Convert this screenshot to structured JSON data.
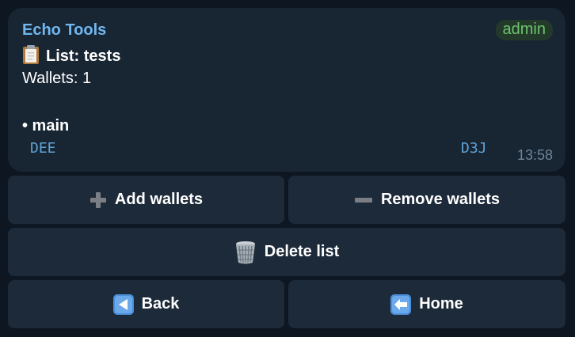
{
  "message": {
    "sender": "Echo Tools",
    "badge": "admin",
    "list_line": "List: tests",
    "wallets_line": "Wallets: 1",
    "item_line": "• main",
    "code_left": "DEE",
    "code_right": "D3J",
    "time": "13:58"
  },
  "keyboard": {
    "add_label": "Add wallets",
    "remove_label": "Remove wallets",
    "delete_label": "Delete list",
    "back_label": "Back",
    "home_label": "Home"
  },
  "icons": {
    "list": "clipboard-icon",
    "add": "plus-icon",
    "remove": "minus-icon",
    "delete": "wastebasket-icon",
    "back": "back-arrow-icon",
    "home": "left-arrow-icon"
  },
  "colors": {
    "background": "#0e1621",
    "bubble": "#182533",
    "sender": "#70b7f0",
    "badge_text": "#6dc46e",
    "code": "#5ea3d6",
    "button": "#1d2a39"
  }
}
